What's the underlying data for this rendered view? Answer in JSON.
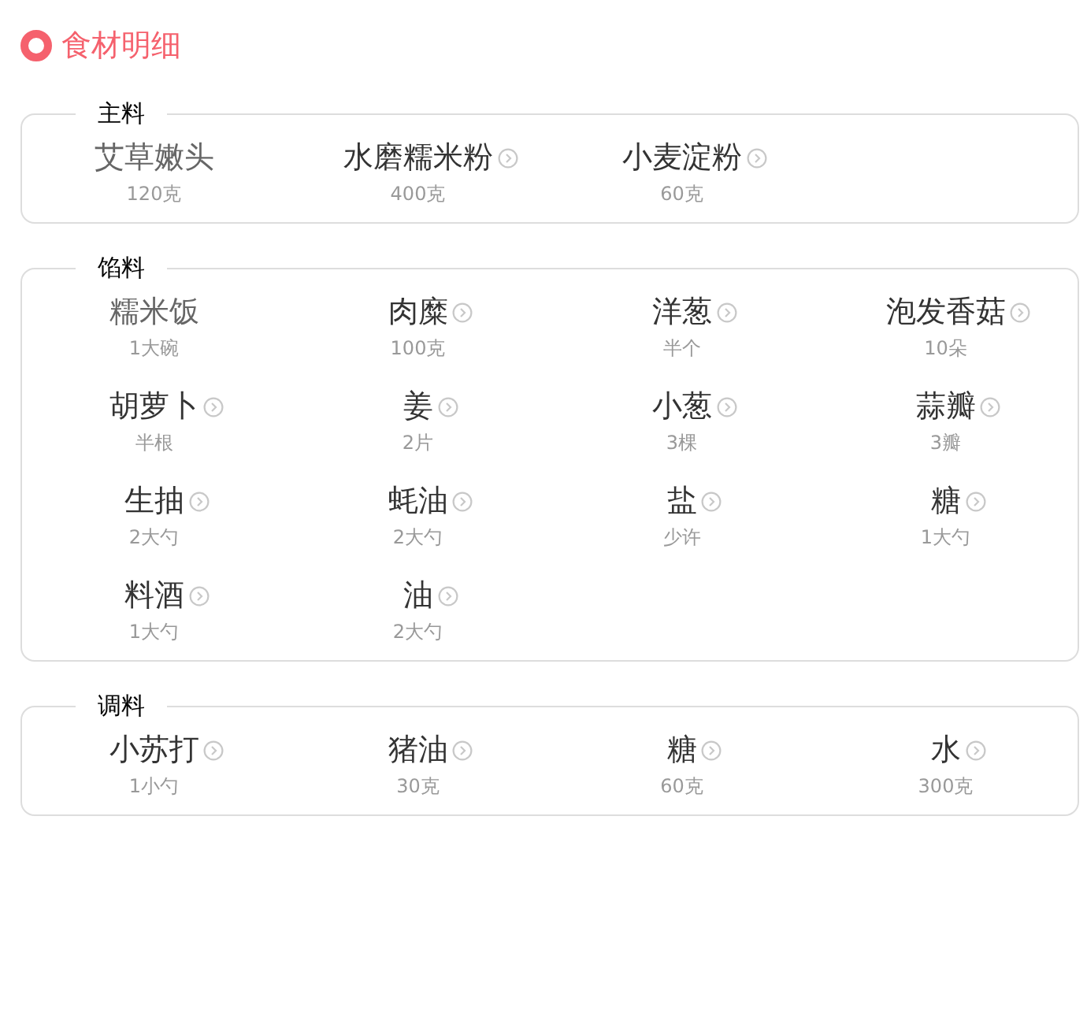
{
  "title": "食材明细",
  "groups": [
    {
      "label": "主料",
      "items": [
        {
          "name": "艾草嫩头",
          "amount": "120克",
          "linked": false
        },
        {
          "name": "水磨糯米粉",
          "amount": "400克",
          "linked": true
        },
        {
          "name": "小麦淀粉",
          "amount": "60克",
          "linked": true
        }
      ]
    },
    {
      "label": "馅料",
      "items": [
        {
          "name": "糯米饭",
          "amount": "1大碗",
          "linked": false
        },
        {
          "name": "肉糜",
          "amount": "100克",
          "linked": true
        },
        {
          "name": "洋葱",
          "amount": "半个",
          "linked": true
        },
        {
          "name": "泡发香菇",
          "amount": "10朵",
          "linked": true
        },
        {
          "name": "胡萝卜",
          "amount": "半根",
          "linked": true
        },
        {
          "name": "姜",
          "amount": "2片",
          "linked": true
        },
        {
          "name": "小葱",
          "amount": "3棵",
          "linked": true
        },
        {
          "name": "蒜瓣",
          "amount": "3瓣",
          "linked": true
        },
        {
          "name": "生抽",
          "amount": "2大勺",
          "linked": true
        },
        {
          "name": "蚝油",
          "amount": "2大勺",
          "linked": true
        },
        {
          "name": "盐",
          "amount": "少许",
          "linked": true
        },
        {
          "name": "糖",
          "amount": "1大勺",
          "linked": true
        },
        {
          "name": "料酒",
          "amount": "1大勺",
          "linked": true
        },
        {
          "name": "油",
          "amount": "2大勺",
          "linked": true
        }
      ]
    },
    {
      "label": "调料",
      "items": [
        {
          "name": "小苏打",
          "amount": "1小勺",
          "linked": true
        },
        {
          "name": "猪油",
          "amount": "30克",
          "linked": true
        },
        {
          "name": "糖",
          "amount": "60克",
          "linked": true
        },
        {
          "name": "水",
          "amount": "300克",
          "linked": true
        }
      ]
    }
  ]
}
